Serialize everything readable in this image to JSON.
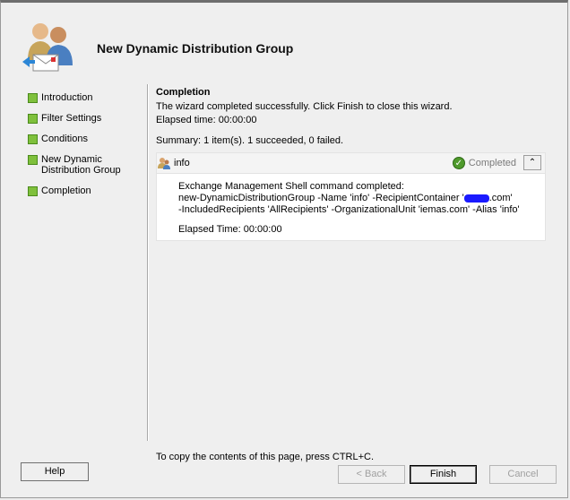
{
  "header": {
    "title": "New Dynamic Distribution Group",
    "icon": "users-mail-icon"
  },
  "nav": [
    {
      "label": "Introduction"
    },
    {
      "label": "Filter Settings"
    },
    {
      "label": "Conditions"
    },
    {
      "label": "New Dynamic Distribution Group"
    },
    {
      "label": "Completion"
    }
  ],
  "content": {
    "title": "Completion",
    "message": "The wizard completed successfully. Click Finish to close this wizard.",
    "elapsed": "Elapsed time: 00:00:00",
    "summary": "Summary: 1 item(s). 1 succeeded, 0 failed."
  },
  "panel": {
    "name": "info",
    "status": "Completed",
    "lines": {
      "l1": "Exchange Management Shell command completed:",
      "l2a": "new-DynamicDistributionGroup -Name 'info' -RecipientContainer '",
      "l2b": ".com'",
      "l3": "-IncludedRecipients 'AllRecipients' -OrganizationalUnit 'iemas.com' -Alias 'info'"
    },
    "elapsed": "Elapsed Time: 00:00:00"
  },
  "hint": "To copy the contents of this page, press CTRL+C.",
  "buttons": {
    "help": "Help",
    "back": "< Back",
    "finish": "Finish",
    "cancel": "Cancel"
  },
  "colors": {
    "step": "#7fc03c",
    "completed": "#4f9a2c",
    "redaction": "#1a1aff"
  }
}
